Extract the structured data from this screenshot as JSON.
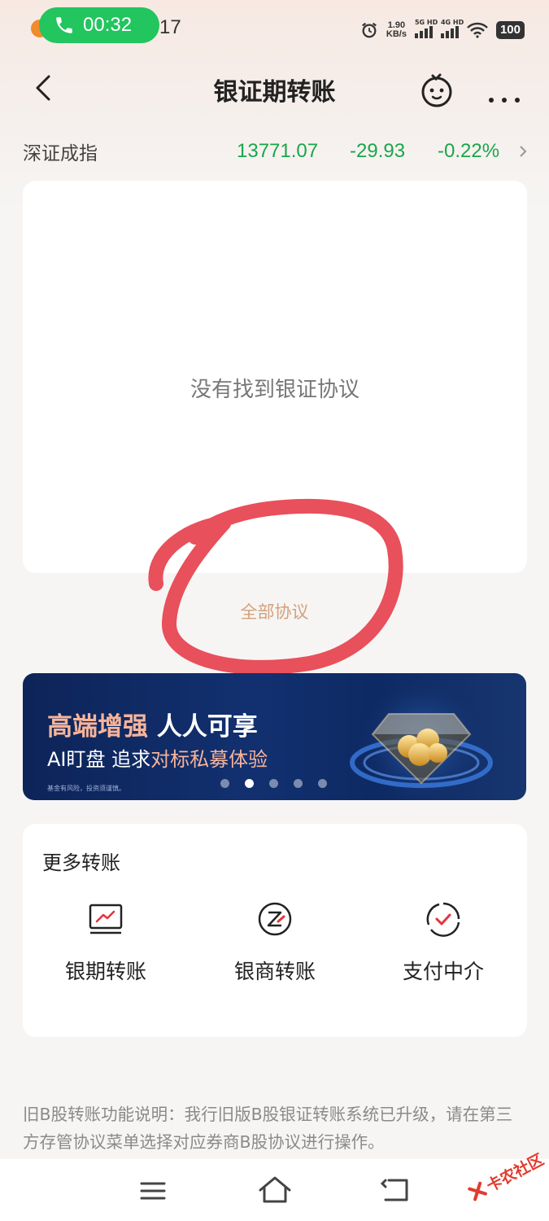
{
  "status_bar": {
    "call_timer": "00:32",
    "time_partial": "17",
    "net_speed_value": "1.90",
    "net_speed_unit": "KB/s",
    "sim1_label": "5G HD",
    "sim2_label": "4G HD",
    "battery": "100"
  },
  "header": {
    "title": "银证期转账"
  },
  "market_index": {
    "name": "深证成指",
    "value": "13771.07",
    "change": "-29.93",
    "change_pct": "-0.22%",
    "color": "#1aa64b"
  },
  "empty_state": {
    "message": "没有找到银证协议",
    "link_label": "全部协议"
  },
  "banner": {
    "title_part1": "高端增强",
    "title_part2": "人人可享",
    "subtitle_part1": "AI盯盘 追求",
    "subtitle_part2": "对标私募体验",
    "disclaimer": "基金有风险，投资须谨慎。",
    "slide_count": 5,
    "active_slide": 2
  },
  "more_transfers": {
    "title": "更多转账",
    "items": [
      {
        "label": "银期转账",
        "icon": "monitor-chart-icon"
      },
      {
        "label": "银商转账",
        "icon": "z-circle-icon"
      },
      {
        "label": "支付中介",
        "icon": "check-circle-icon"
      }
    ]
  },
  "footer_note": "旧B股转账功能说明：我行旧版B股银证转账系统已升级，请在第三方存管协议菜单选择对应券商B股协议进行操作。",
  "watermark": "卡农社区",
  "colors": {
    "accent_red": "#e8323c",
    "annotation_red": "#e8505b",
    "link_gold": "#d4a07a",
    "banner_blue": "#0f2a66"
  }
}
